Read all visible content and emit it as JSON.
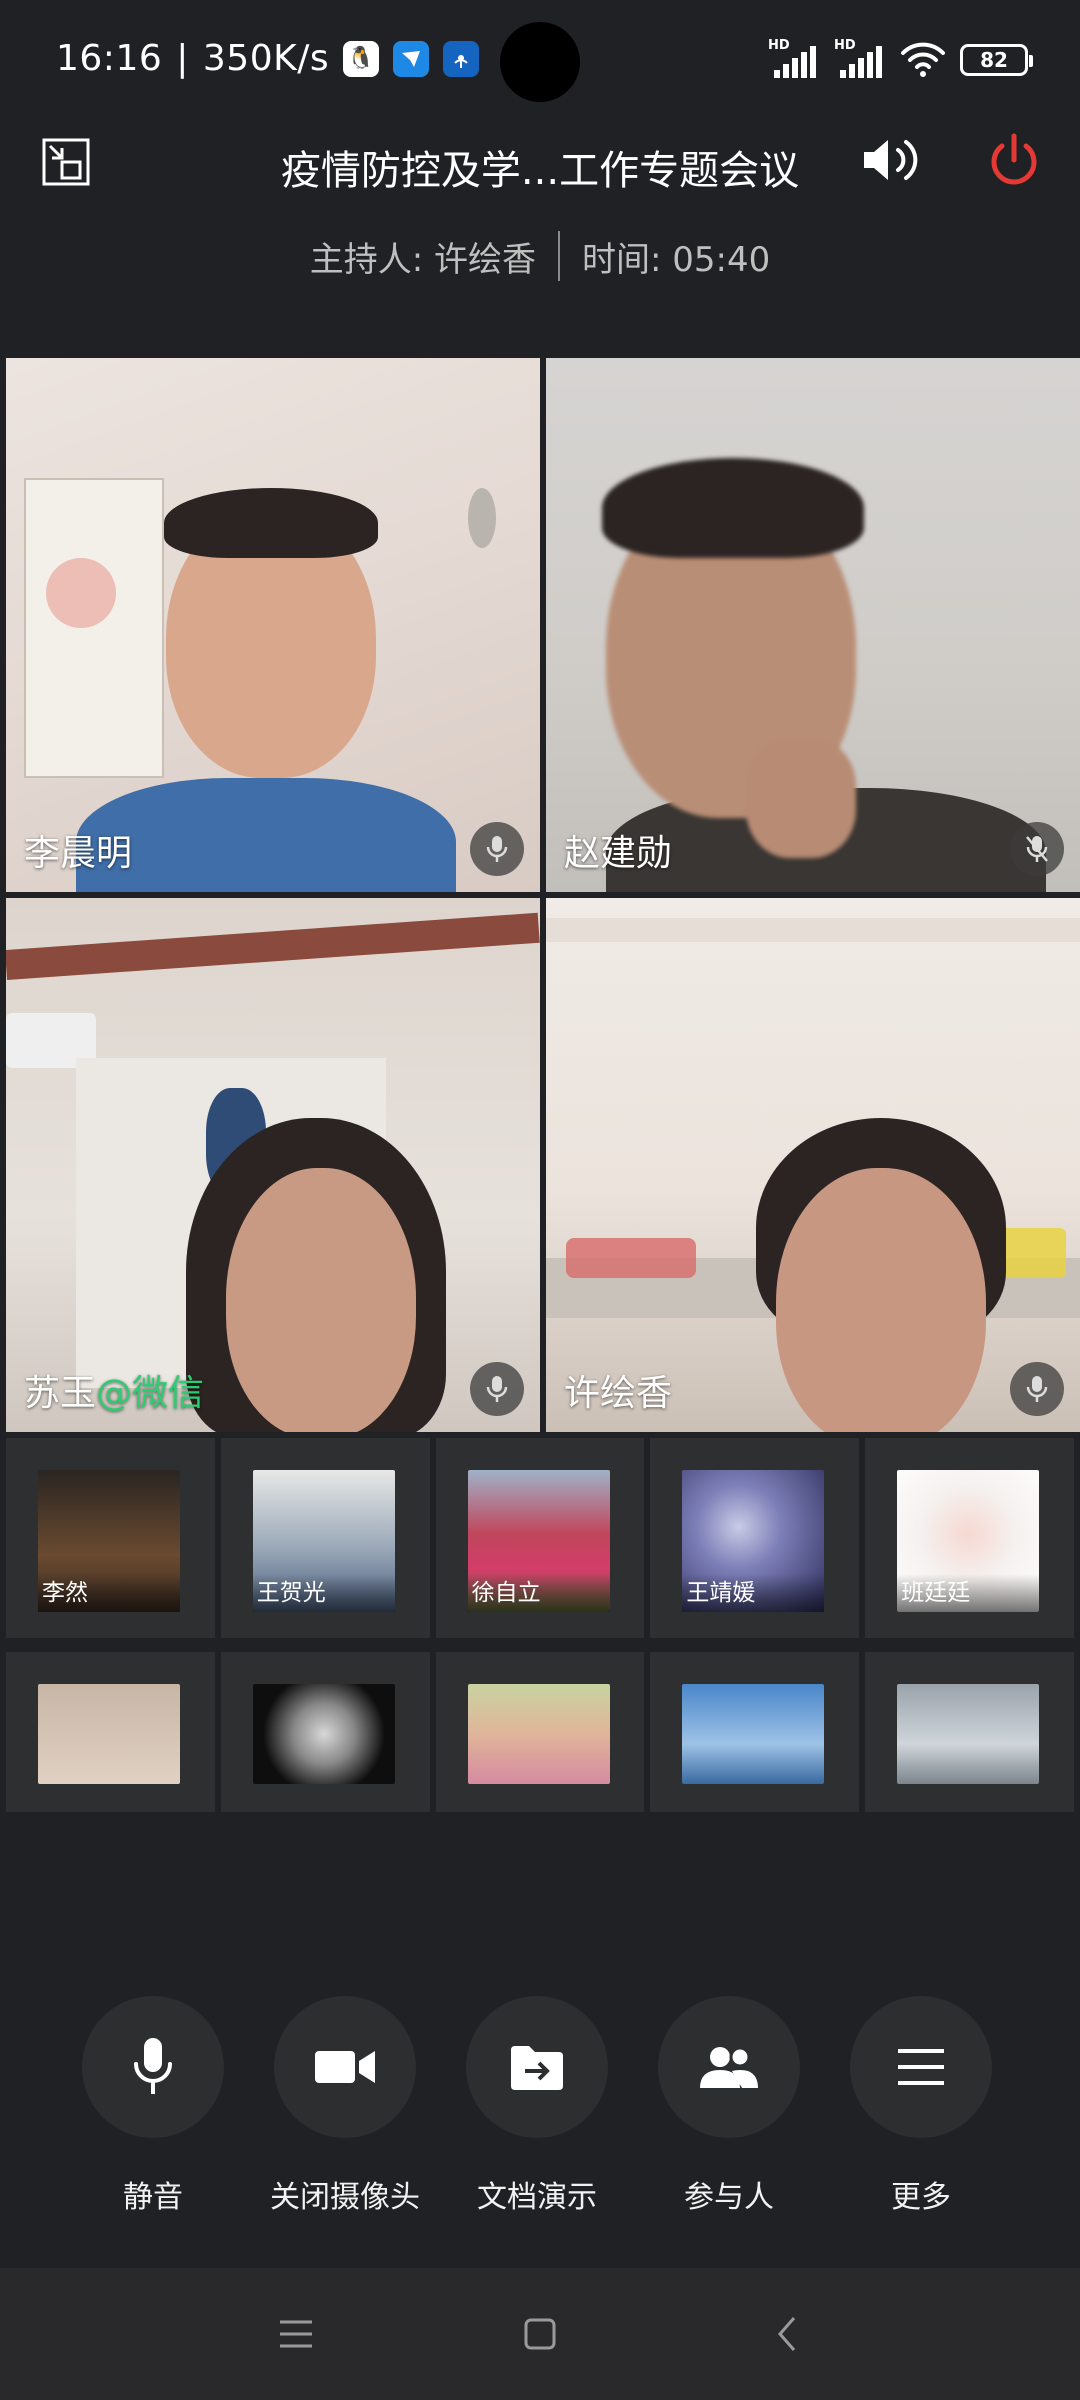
{
  "status_bar": {
    "time": "16:16",
    "network_speed": "350K/s",
    "separator": "|",
    "app_icons": [
      "qq-icon",
      "feishu-icon",
      "hotspot-icon"
    ],
    "signal_label": "HD",
    "battery": "82"
  },
  "header": {
    "title": "疫情防控及学...工作专题会议",
    "host_label": "主持人: 许绘香",
    "time_label": "时间: 05:40"
  },
  "video_tiles": [
    {
      "name": "李晨明",
      "mic": "mic-icon"
    },
    {
      "name": "赵建勋",
      "mic": "mic-icon"
    },
    {
      "name": "苏玉",
      "name_tag": "@微信",
      "mic": "mic-icon"
    },
    {
      "name": "许绘香",
      "mic": "mic-icon"
    }
  ],
  "participants_row1": [
    "李然",
    "王贺光",
    "徐自立",
    "王靖媛",
    "班廷廷"
  ],
  "controls": {
    "mute": "静音",
    "camera_off": "关闭摄像头",
    "doc_share": "文档演示",
    "participants": "参与人",
    "more": "更多"
  },
  "colors": {
    "background": "#202124",
    "power_red": "#e53935",
    "wechat_green": "#2ecc71",
    "button_bg": "#2d2e30"
  }
}
